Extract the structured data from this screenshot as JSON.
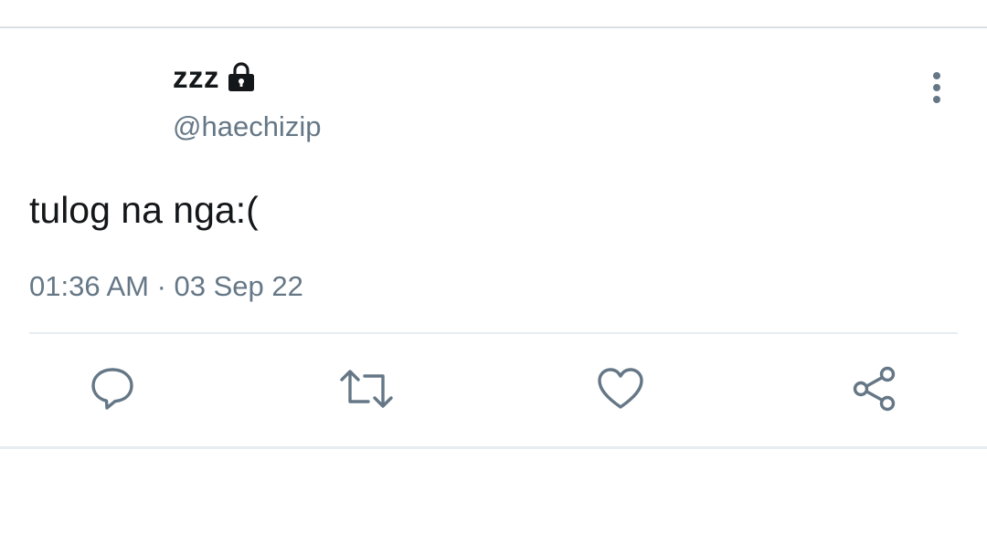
{
  "tweet": {
    "display_name": "zzz",
    "handle": "@haechizip",
    "text": "tulog na nga:(",
    "timestamp": "01:36 AM · 03 Sep 22",
    "protected": true
  },
  "actions": [
    {
      "name": "reply",
      "icon": "reply-icon"
    },
    {
      "name": "retweet",
      "icon": "retweet-icon"
    },
    {
      "name": "like",
      "icon": "heart-icon"
    },
    {
      "name": "share",
      "icon": "share-icon"
    }
  ],
  "colors": {
    "text_primary": "#14171a",
    "text_secondary": "#657786",
    "icon": "#657786",
    "divider": "#e6ecf0"
  }
}
